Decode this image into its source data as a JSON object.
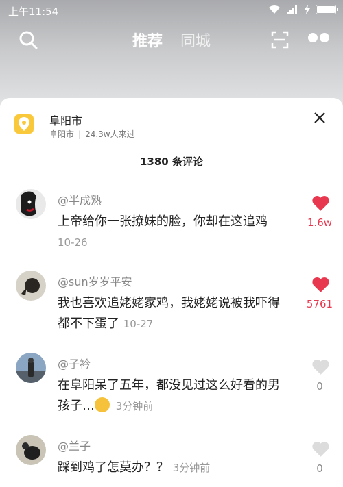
{
  "status_bar": {
    "time": "上午11:54"
  },
  "nav": {
    "tab_active": "推荐",
    "tab_inactive": "同城"
  },
  "location": {
    "title": "阜阳市",
    "city": "阜阳市",
    "visitors": "24.3w人来过"
  },
  "comments_header": {
    "count": "1380 条评论"
  },
  "comments": [
    {
      "user": "@半成熟",
      "text": "上帝给你一张撩妹的脸，你却在这追鸡",
      "time": "10-26",
      "likes": "1.6w",
      "liked": true
    },
    {
      "user": "@sun岁岁平安",
      "text": "我也喜欢追姥姥家鸡，我姥姥说被我吓得都不下蛋了",
      "time": "10-27",
      "likes": "5761",
      "liked": true
    },
    {
      "user": "@子衿",
      "text": "在阜阳呆了五年，都没见过这么好看的男孩子…",
      "time": "3分钟前",
      "likes": "0",
      "liked": false
    },
    {
      "user": "@兰子",
      "text": "踩到鸡了怎莫办？？",
      "time": "3分钟前",
      "likes": "0",
      "liked": false
    }
  ],
  "colors": {
    "like_red": "#e8384f",
    "like_gray": "#dcdcdc",
    "location_yellow": "#f9c93b"
  }
}
